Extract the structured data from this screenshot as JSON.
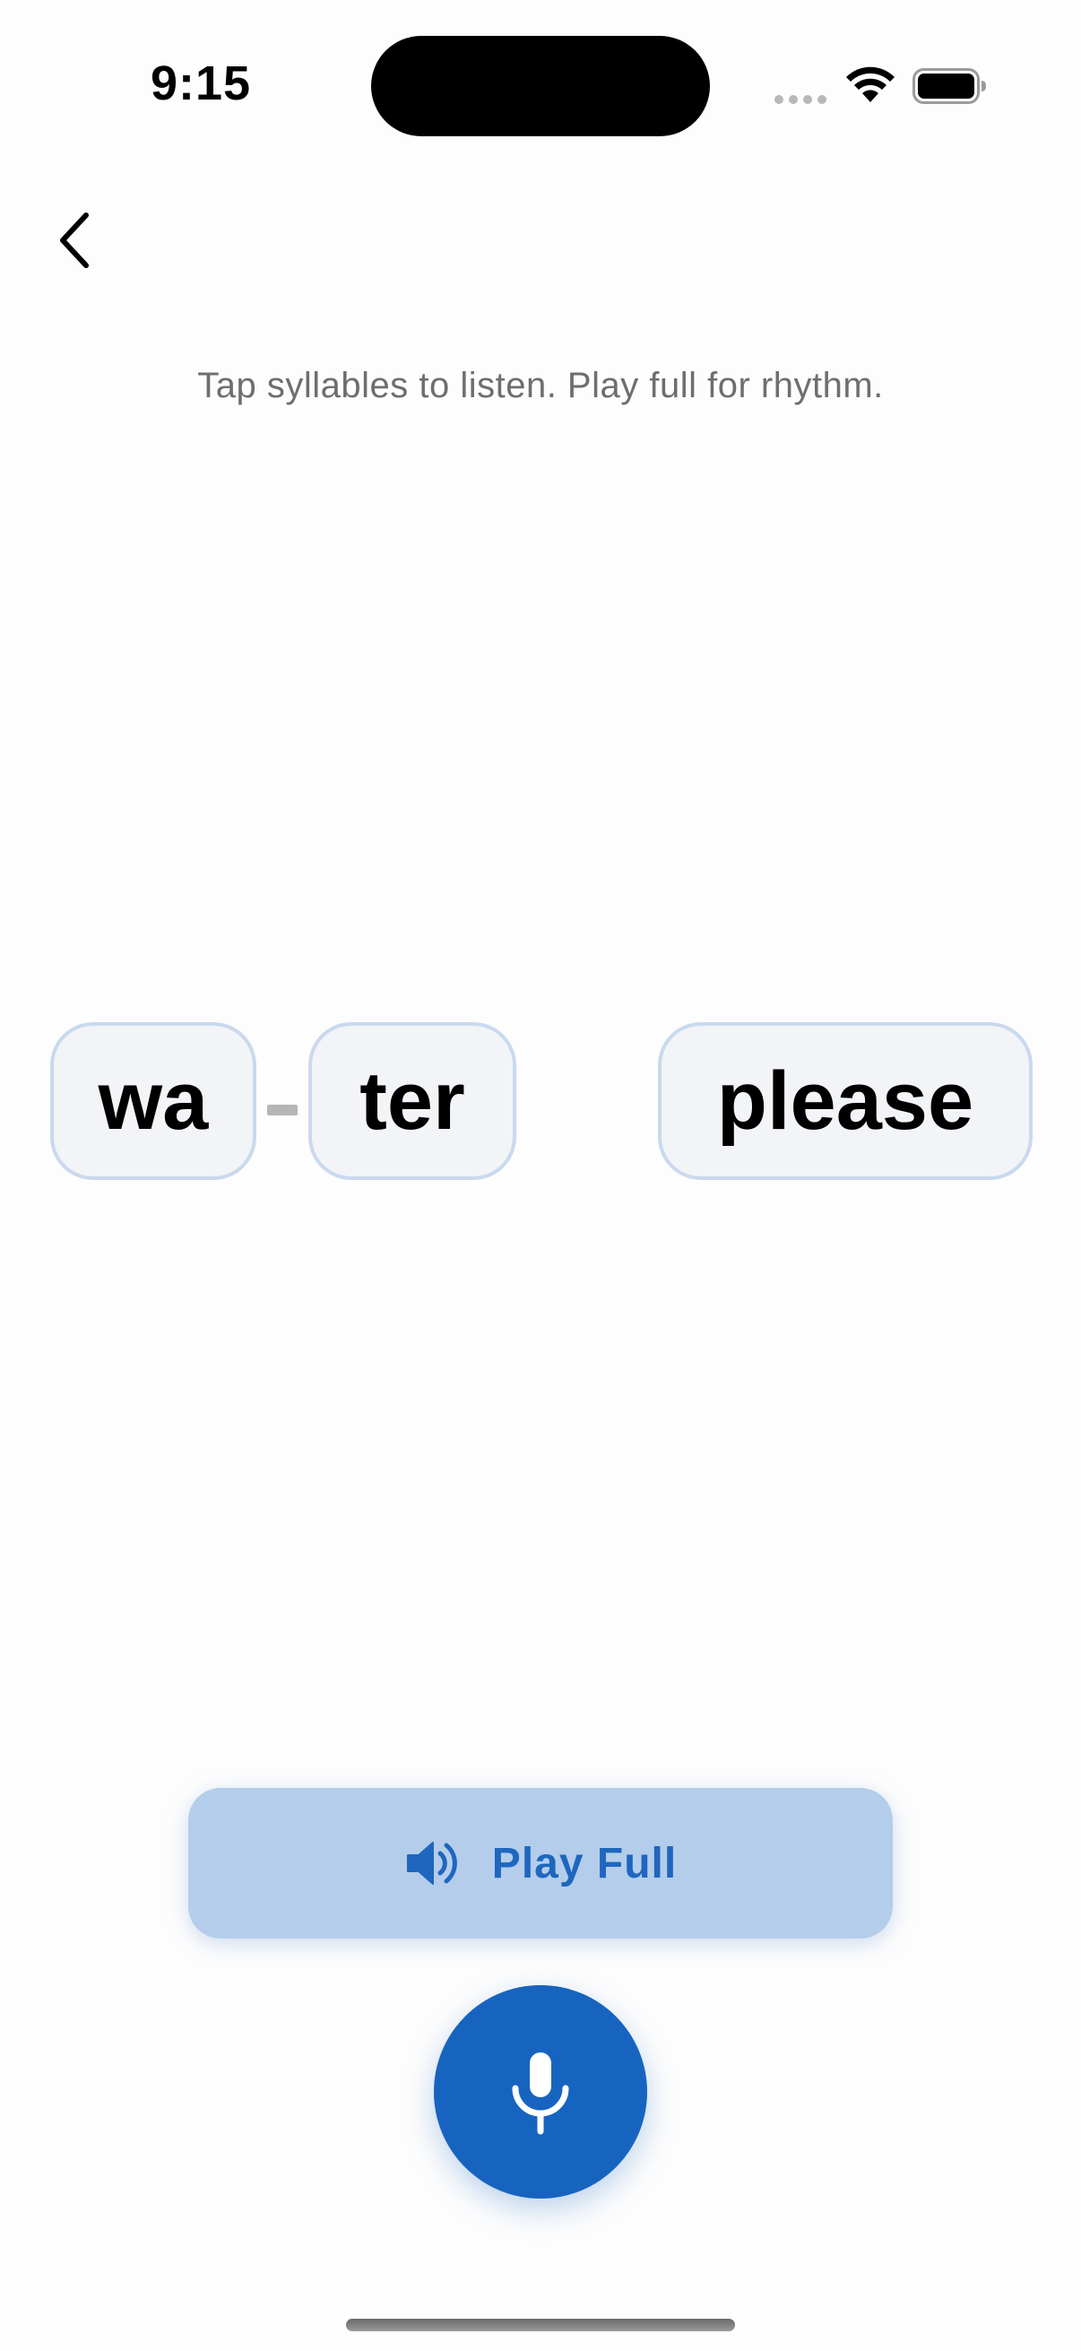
{
  "status_bar": {
    "time": "9:15"
  },
  "nav": {
    "back_icon": "chevron-left-icon"
  },
  "instruction_text": "Tap syllables to listen. Play full for rhythm.",
  "syllables": [
    {
      "text": "wa"
    },
    {
      "text": "ter"
    },
    {
      "text": "please"
    }
  ],
  "play_full": {
    "label": "Play Full",
    "icon": "speaker-icon"
  },
  "mic": {
    "icon": "microphone-icon"
  },
  "colors": {
    "accent": "#1764c0",
    "play_button_bg": "#b4cdeb",
    "chip_bg": "#f2f4f7",
    "chip_border": "#c9d9ee",
    "instruction_text": "#6e6e6e"
  }
}
